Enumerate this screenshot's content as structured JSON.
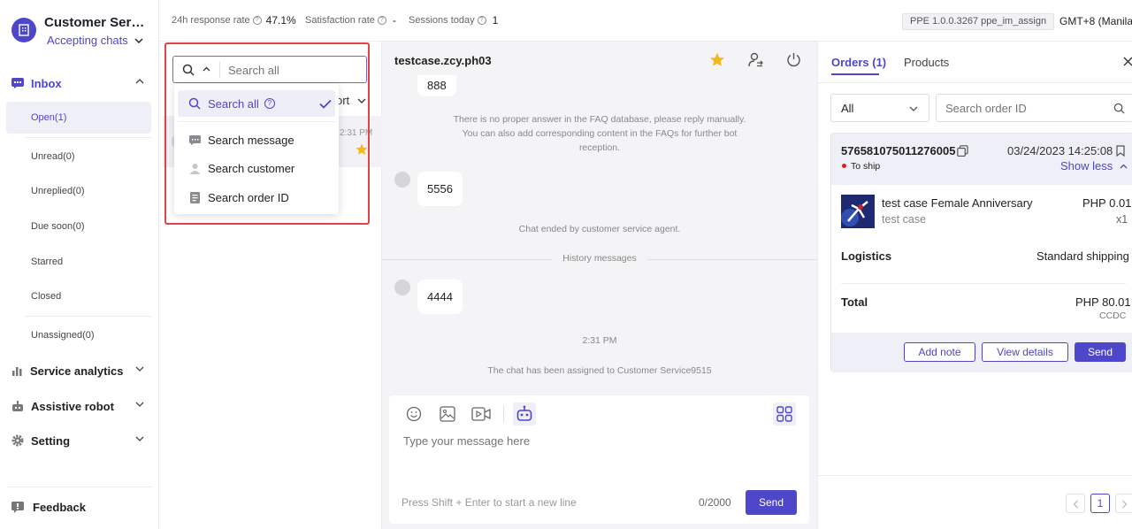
{
  "sidebar": {
    "title": "Customer Servi...",
    "status": "Accepting chats",
    "inbox_label": "Inbox",
    "inbox_items": [
      "Open(1)",
      "Unread(0)",
      "Unreplied(0)",
      "Due soon(0)",
      "Starred",
      "Closed",
      "Unassigned(0)"
    ],
    "sections": [
      "Service analytics",
      "Assistive robot",
      "Setting"
    ],
    "feedback": "Feedback"
  },
  "topbar": {
    "metrics": [
      {
        "label": "24h response rate",
        "value": "47.1%"
      },
      {
        "label": "Satisfaction rate",
        "value": "-"
      },
      {
        "label": "Sessions today",
        "value": "1"
      }
    ],
    "version": "PPE 1.0.0.3267 ppe_im_assign",
    "timezone": "GMT+8 (Manila"
  },
  "list": {
    "search_placeholder": "Search all",
    "sort_label": "ort",
    "row_time": "2:31 PM"
  },
  "dropdown": {
    "items": [
      {
        "label": "Search all",
        "icon": "search-icon",
        "selected": true
      },
      {
        "label": "Search message",
        "icon": "message-icon",
        "selected": false
      },
      {
        "label": "Search customer",
        "icon": "customer-icon",
        "selected": false
      },
      {
        "label": "Search order ID",
        "icon": "order-icon",
        "selected": false
      }
    ]
  },
  "chat": {
    "name": "testcase.zcy.ph03",
    "msg_top": "888",
    "faq_notice": "There is no proper answer in the FAQ database, please reply manually. You can also add corresponding content in the FAQs for further bot reception.",
    "msg_5556": "5556",
    "ended_notice": "Chat ended by customer service agent.",
    "history_label": "History messages",
    "msg_4444": "4444",
    "time_label": "2:31 PM",
    "assigned_notice": "The chat has been assigned to Customer Service9515",
    "input_placeholder": "Type your message here",
    "hint": "Press Shift + Enter to start a new line",
    "counter": "0/2000",
    "send_label": "Send"
  },
  "orders": {
    "tabs": [
      "Orders (1)",
      "Products"
    ],
    "filter_value": "All",
    "search_placeholder": "Search order ID",
    "order_id": "576581075011276005",
    "datetime": "03/24/2023 14:25:08",
    "status": "To ship",
    "show_less": "Show less",
    "product_name": "test case Female Anniversary",
    "product_variant": "test case",
    "price": "PHP 0.01",
    "qty": "x1",
    "logistics_label": "Logistics",
    "logistics_value": "Standard shipping",
    "total_label": "Total",
    "total_value": "PHP 80.01",
    "total_sub": "CCDC",
    "add_note": "Add note",
    "view_details": "View details",
    "send": "Send",
    "page": "1"
  },
  "colors": {
    "accent": "#4e47c9",
    "highlight": "#e04444",
    "star": "#f5b814",
    "status_dot": "#e02020"
  }
}
